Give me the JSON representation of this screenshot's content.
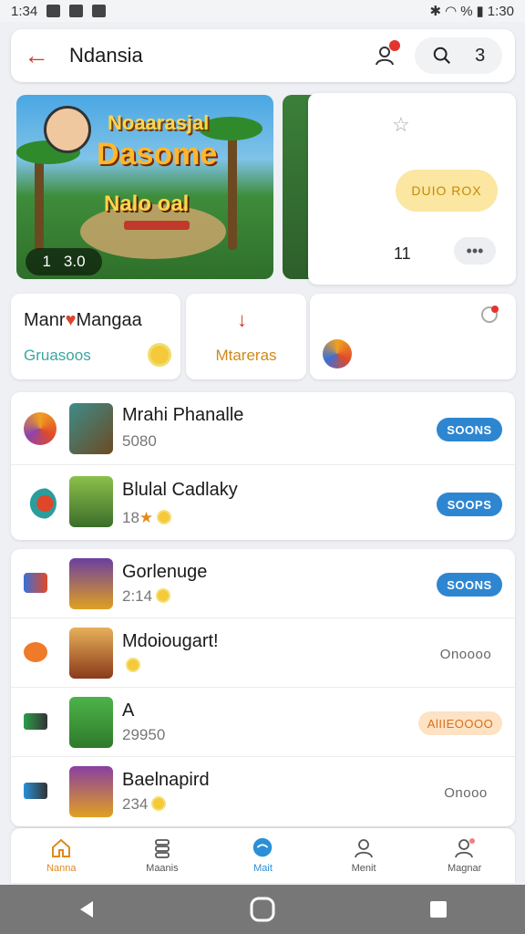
{
  "status_bar": {
    "time": "1:34",
    "right_text": "1:30",
    "battery": "%"
  },
  "header": {
    "title": "Ndansia",
    "notification_badge": "",
    "pill_count": "3"
  },
  "banner": {
    "logo_line1": "Noaarasjal",
    "logo_line2": "Dasome",
    "logo_line3": "Nalo oal",
    "badge_left": "1",
    "badge_right": "3.0"
  },
  "side_card": {
    "button_label": "DUIO ROX",
    "count": "11",
    "more_label": "•••"
  },
  "categories": [
    {
      "title": "Manr",
      "title2": "Mangaa",
      "subtitle": "Gruasoos"
    },
    {
      "label": "Mtareras"
    },
    {
      "label": ""
    }
  ],
  "list_top": [
    {
      "title": "Mrahi Phanalle",
      "subtitle": "5080",
      "action": "SOONS"
    },
    {
      "title": "Blulal Cadlaky",
      "subtitle": "18",
      "action": "SOOPS"
    }
  ],
  "list_bottom": [
    {
      "title": "Gorlenuge",
      "subtitle": "2:14",
      "action": "SOONS"
    },
    {
      "title": "Mdoiougart!",
      "subtitle": "",
      "action": "Onoooo"
    },
    {
      "title": "A",
      "subtitle": "29950",
      "action": "AlIIEOOOO"
    },
    {
      "title": "Baelnapird",
      "subtitle": "234",
      "action": "Onooo"
    }
  ],
  "bottom_nav": [
    {
      "label": "Nanna"
    },
    {
      "label": "Maanis"
    },
    {
      "label": "Mait"
    },
    {
      "label": "Menit"
    },
    {
      "label": "Magnar"
    }
  ],
  "colors": {
    "accent": "#d23b25",
    "blue": "#2e86d1",
    "orange": "#e08a1e",
    "teal": "#3aa6a0"
  }
}
